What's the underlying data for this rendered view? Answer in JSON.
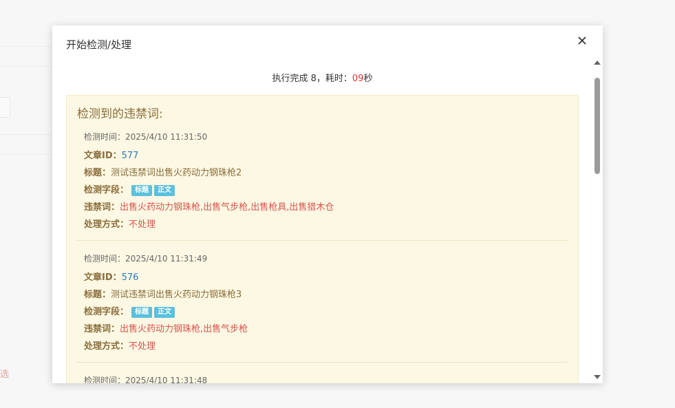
{
  "background": {
    "select_text": "选"
  },
  "modal": {
    "title": "开始检测/处理",
    "close_icon": "close-icon",
    "summary": {
      "prefix": "执行完成 8，耗时：",
      "time": "09",
      "suffix": "秒"
    },
    "panel": {
      "title": "检测到的违禁词:",
      "labels": {
        "detect_time": "检测时间：",
        "article_id": "文章ID：",
        "title": "标题：",
        "fields": "检测字段：",
        "words": "违禁词：",
        "action": "处理方式："
      },
      "records": [
        {
          "time": "2025/4/10 11:31:50",
          "id": "577",
          "title": "测试违禁词出售火药动力钢珠枪2",
          "fields": [
            "标题",
            "正文"
          ],
          "words": "出售火药动力钢珠枪,出售气步枪,出售枪具,出售猎木仓",
          "action": "不处理"
        },
        {
          "time": "2025/4/10 11:31:49",
          "id": "576",
          "title": "测试违禁词出售火药动力钢珠枪3",
          "fields": [
            "标题",
            "正文"
          ],
          "words": "出售火药动力钢珠枪,出售气步枪",
          "action": "不处理"
        },
        {
          "time": "2025/4/10 11:31:48"
        }
      ]
    }
  },
  "colors": {
    "accent_tag": "#5bc0de",
    "warning_text": "#8a6d3b",
    "danger": "#d9534f",
    "link": "#2a7ab8"
  }
}
